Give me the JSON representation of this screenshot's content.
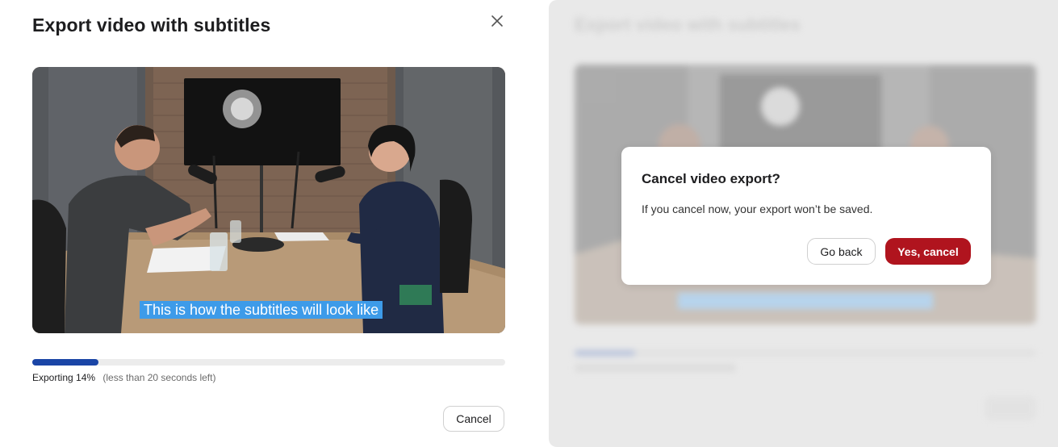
{
  "export_dialog": {
    "title": "Export video with subtitles",
    "close_icon": "close-icon",
    "subtitle_preview": "This is how the subtitles will look like",
    "progress": {
      "percent": 14,
      "status_text": "Exporting 14%",
      "time_left_text": "(less than 20 seconds left)"
    },
    "cancel_label": "Cancel"
  },
  "confirm_dialog": {
    "title": "Cancel video export?",
    "body": "If you cancel now, your export won’t be saved.",
    "go_back_label": "Go back",
    "confirm_label": "Yes, cancel"
  },
  "colors": {
    "progress": "#1a45a6",
    "subtitle_highlight": "#3d9be9",
    "danger": "#b0141e"
  }
}
